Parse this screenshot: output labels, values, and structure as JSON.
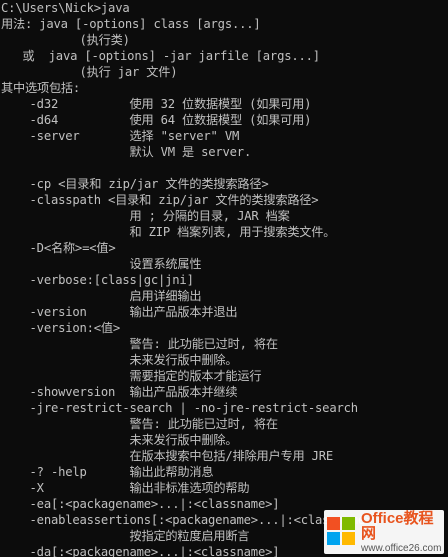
{
  "console": {
    "lines": [
      "C:\\Users\\Nick>java",
      "用法: java [-options] class [args...]",
      "           (执行类)",
      "   或  java [-options] -jar jarfile [args...]",
      "           (执行 jar 文件)",
      "其中选项包括:",
      "    -d32          使用 32 位数据模型 (如果可用)",
      "    -d64          使用 64 位数据模型 (如果可用)",
      "    -server       选择 \"server\" VM",
      "                  默认 VM 是 server.",
      "",
      "    -cp <目录和 zip/jar 文件的类搜索路径>",
      "    -classpath <目录和 zip/jar 文件的类搜索路径>",
      "                  用 ; 分隔的目录, JAR 档案",
      "                  和 ZIP 档案列表, 用于搜索类文件。",
      "    -D<名称>=<值>",
      "                  设置系统属性",
      "    -verbose:[class|gc|jni]",
      "                  启用详细输出",
      "    -version      输出产品版本并退出",
      "    -version:<值>",
      "                  警告: 此功能已过时, 将在",
      "                  未来发行版中删除。",
      "                  需要指定的版本才能运行",
      "    -showversion  输出产品版本并继续",
      "    -jre-restrict-search | -no-jre-restrict-search",
      "                  警告: 此功能已过时, 将在",
      "                  未来发行版中删除。",
      "                  在版本搜索中包括/排除用户专用 JRE",
      "    -? -help      输出此帮助消息",
      "    -X            输出非标准选项的帮助",
      "    -ea[:<packagename>...|:<classname>]",
      "    -enableassertions[:<packagename>...|:<classname>]",
      "                  按指定的粒度启用断言",
      "    -da[:<packagename>...|:<classname>]"
    ]
  },
  "watermark": {
    "title": "Office教程网",
    "url": "www.office26.com",
    "logo_colors": [
      "#f25022",
      "#7fba00",
      "#00a4ef",
      "#ffb900"
    ]
  },
  "colors": {
    "background": "#0c0c0c",
    "foreground": "#c0c0c0",
    "watermark_title": "#e8541e"
  }
}
